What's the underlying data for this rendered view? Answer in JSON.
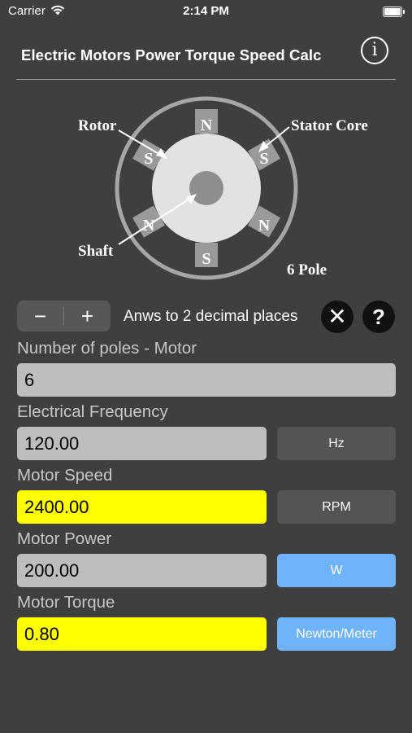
{
  "status_bar": {
    "carrier": "Carrier",
    "time": "2:14 PM"
  },
  "header": {
    "title": "Electric Motors Power Torque Speed Calc",
    "info_symbol": "i"
  },
  "diagram": {
    "labels": {
      "rotor": "Rotor",
      "stator_core": "Stator Core",
      "shaft": "Shaft",
      "pole_count": "6 Pole"
    },
    "poles": [
      "N",
      "S",
      "N",
      "S",
      "N",
      "S"
    ]
  },
  "controls": {
    "minus_label": "−",
    "plus_label": "+",
    "decimal_text": "Anws to 2 decimal places",
    "clear_label": "✕",
    "help_label": "?"
  },
  "fields": {
    "poles": {
      "label": "Number of poles - Motor",
      "value": "6"
    },
    "frequency": {
      "label": "Electrical Frequency",
      "value": "120.00",
      "unit": "Hz"
    },
    "speed": {
      "label": "Motor Speed",
      "value": "2400.00",
      "unit": "RPM"
    },
    "power": {
      "label": "Motor Power",
      "value": "200.00",
      "unit": "W"
    },
    "torque": {
      "label": "Motor Torque",
      "value": "0.80",
      "unit": "Newton/Meter"
    }
  },
  "colors": {
    "background": "#3f3f3f",
    "input_gray": "#bdbdbd",
    "input_highlight": "#ffff00",
    "unit_dark": "#545454",
    "unit_active": "#6fb3fb"
  }
}
